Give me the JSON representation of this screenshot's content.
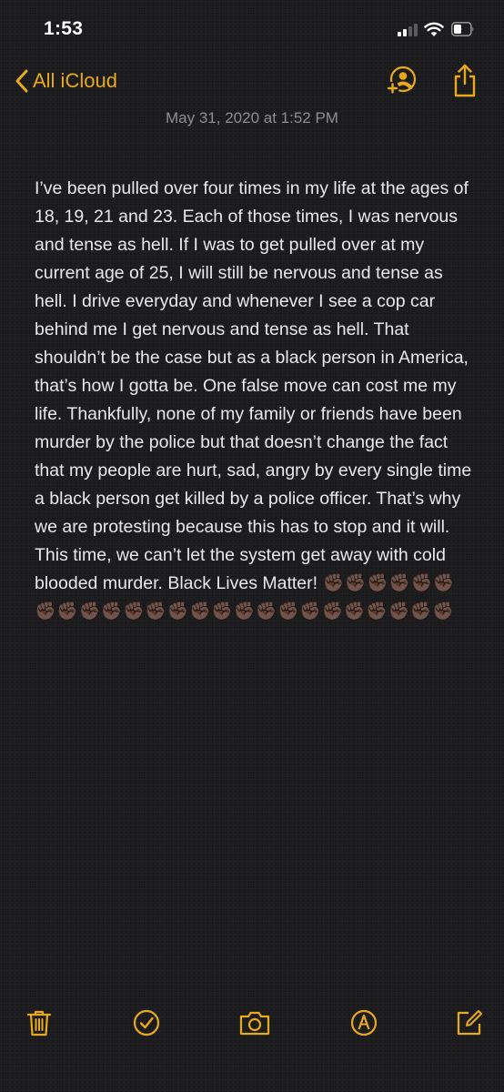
{
  "status_bar": {
    "time": "1:53"
  },
  "nav": {
    "back_label": "All iCloud"
  },
  "note": {
    "date": "May 31, 2020 at 1:52 PM",
    "body": "I’ve been pulled over four times in my life at the ages of 18, 19, 21 and 23. Each of those times, I was nervous and tense as hell. If I was to get pulled over at my current age of 25, I will still be nervous and tense as hell. I drive everyday and whenever I see a cop car behind me I get nervous and tense as hell. That shouldn’t be the case but as a black person in America, that’s how I gotta be. One false move can cost me my life. Thankfully, none of my family or friends have been murder by the police but that doesn’t change the fact that my people are hurt, sad, angry by every single time a black person get killed by a police officer. That’s why we are protesting because this has to stop and it will. This time, we can’t let the system get away with cold blooded murder. Black Lives Matter! ✊🏿✊🏿✊🏿✊🏿✊🏿✊🏿✊🏿✊🏿✊🏿✊🏿✊🏿✊🏿✊🏿✊🏿✊🏿✊🏿✊🏿✊🏿✊🏿✊🏿✊🏿✊🏿✊🏿✊🏿✊🏿"
  },
  "colors": {
    "accent": "#e9a91c",
    "background": "#1c1c1e",
    "text": "#e9e9eb",
    "secondary_text": "#8e8e93"
  },
  "icons": {
    "status": [
      "cellular-signal-icon",
      "wifi-icon",
      "battery-icon"
    ],
    "nav": [
      "chevron-left-icon",
      "add-person-icon",
      "share-icon"
    ],
    "toolbar": [
      "trash-icon",
      "checklist-icon",
      "camera-icon",
      "markup-icon",
      "compose-icon"
    ]
  }
}
